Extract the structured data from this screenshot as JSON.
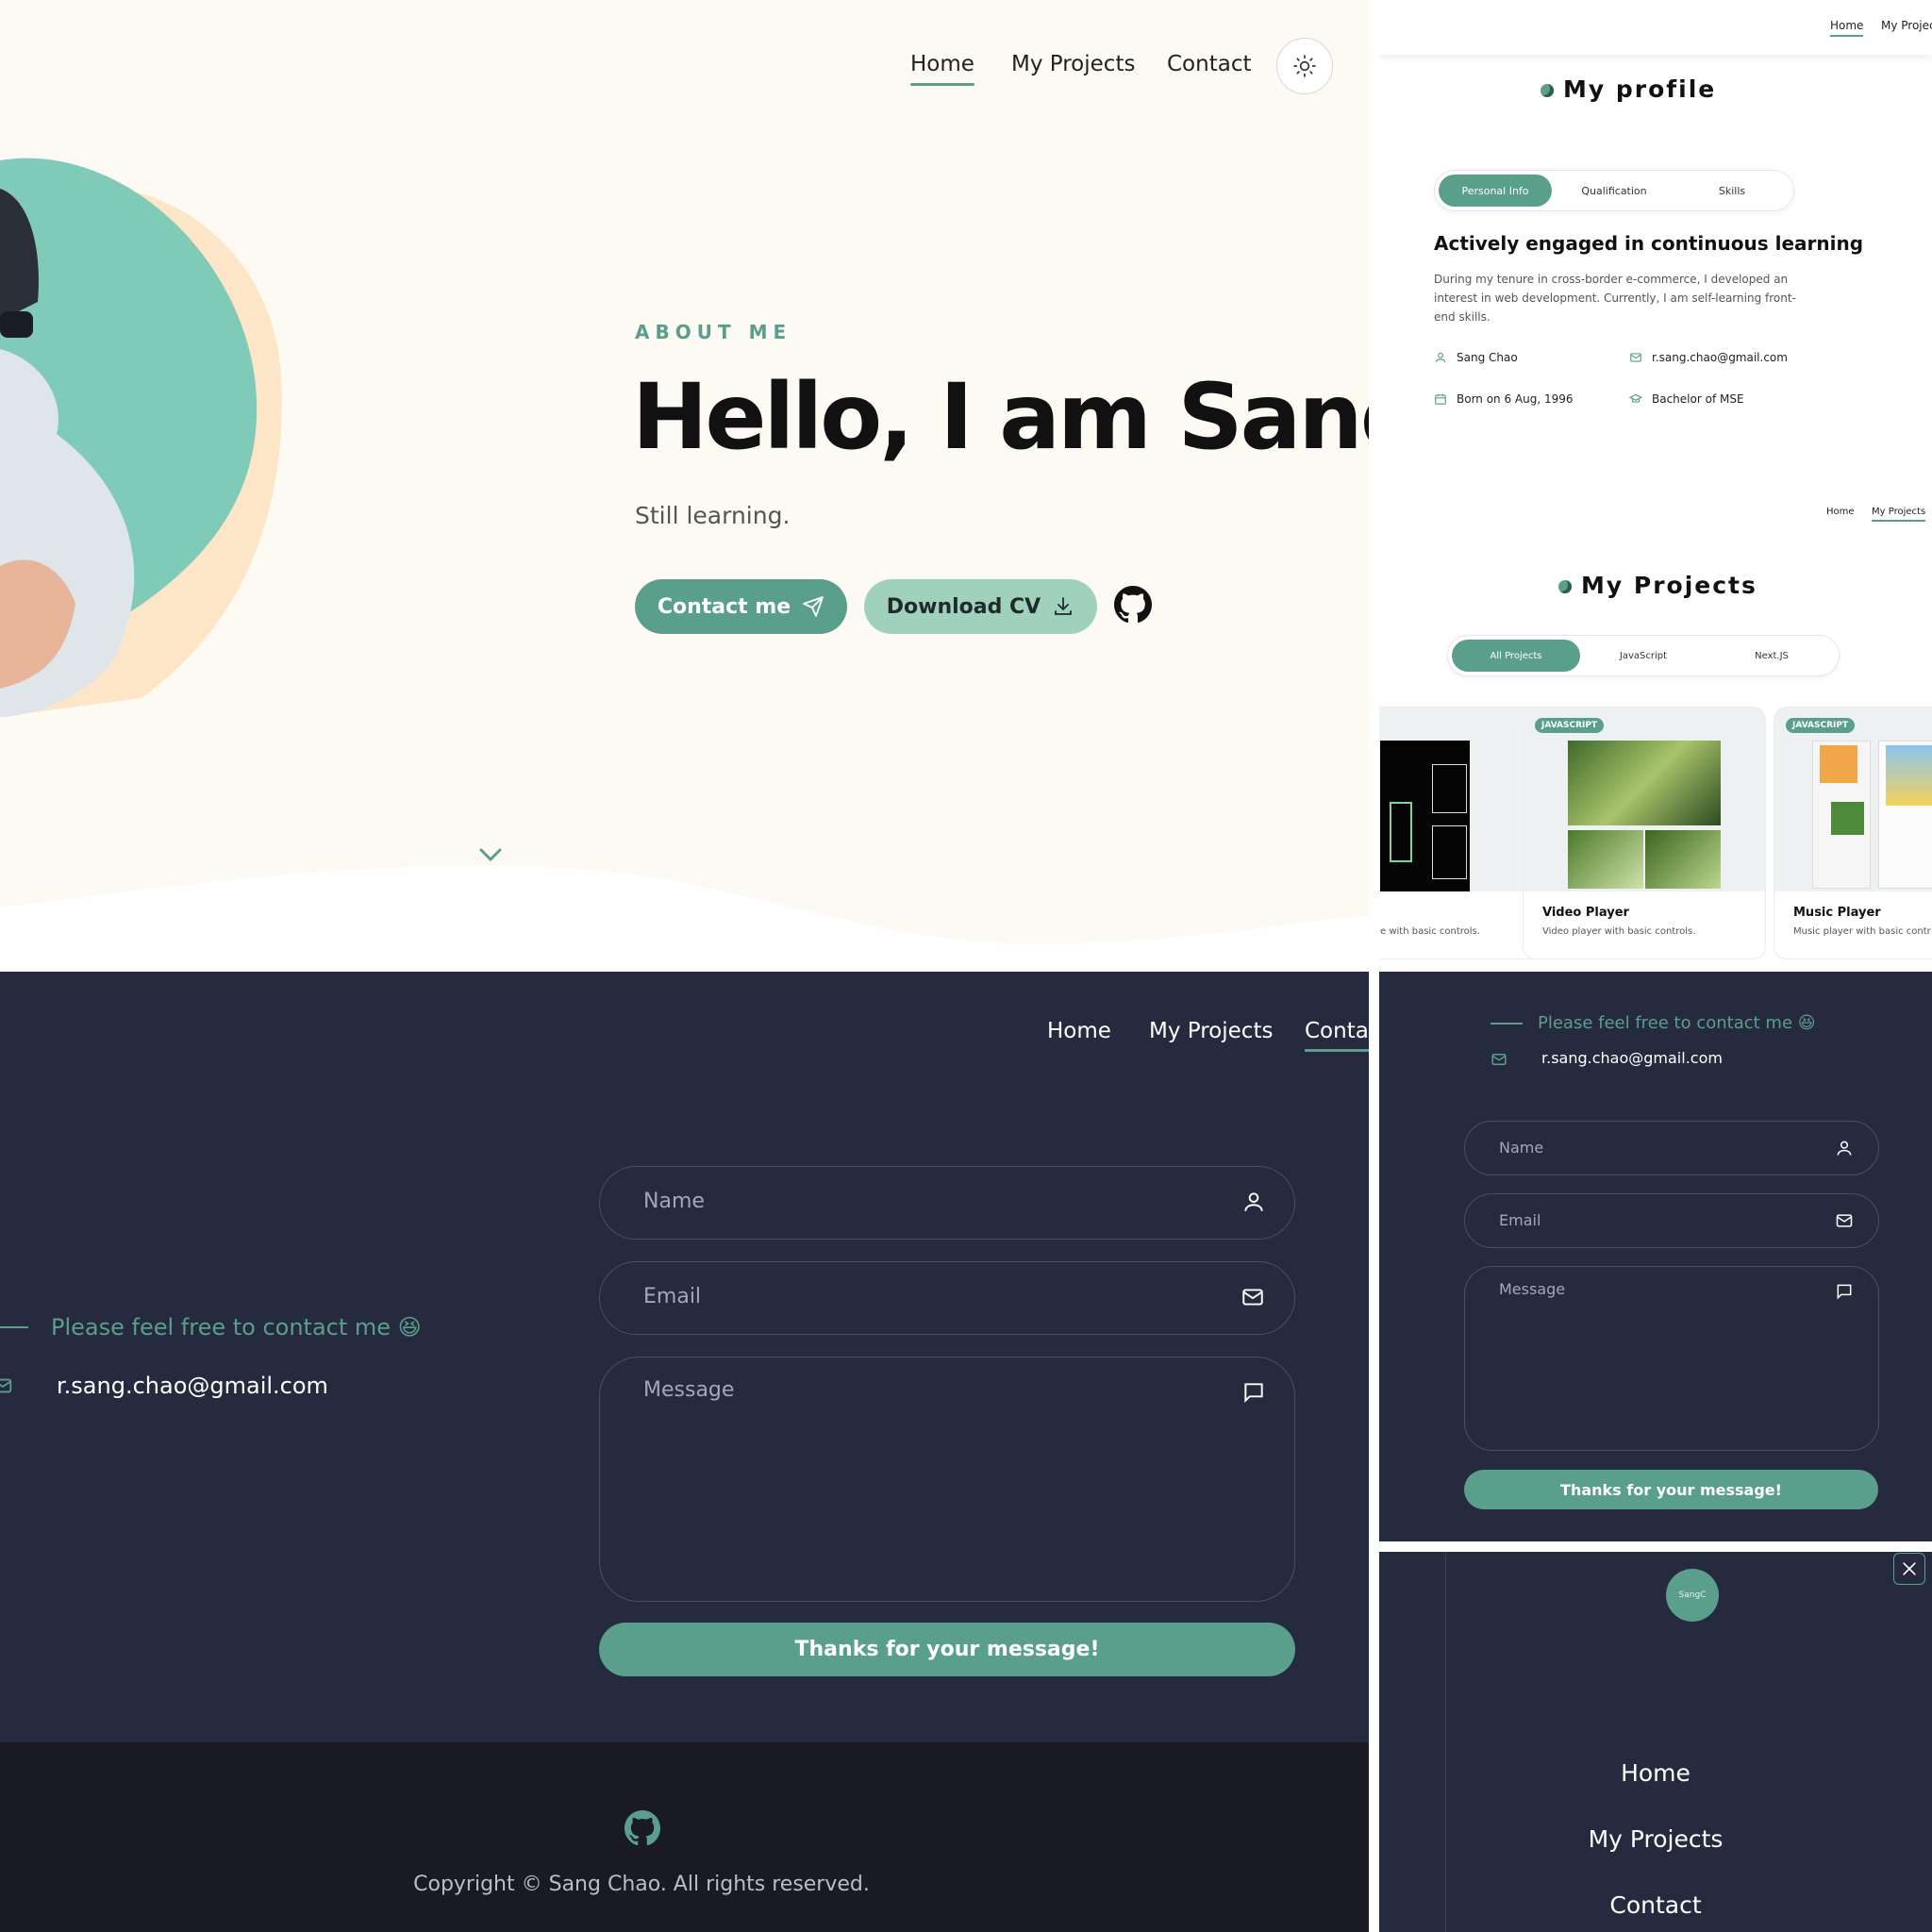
{
  "colors": {
    "accent": "#5a9e8c",
    "accent_light": "#9fd1bd",
    "dark_bg": "#262a3e",
    "cream_bg": "#fdfaf4",
    "footer_bg": "#1a1b22"
  },
  "hero": {
    "nav": {
      "home": "Home",
      "projects": "My Projects",
      "contact": "Contact"
    },
    "theme_icon": "sun-icon",
    "about_label": "ABOUT ME",
    "title": "Hello, I am Sang!",
    "subtitle": "Still learning.",
    "contact_btn": "Contact me",
    "cv_btn": "Download CV"
  },
  "profile": {
    "nav": {
      "home": "Home",
      "projects": "My Projects"
    },
    "title": "My profile",
    "tabs": [
      "Personal Info",
      "Qualification",
      "Skills"
    ],
    "heading": "Actively engaged in continuous learning",
    "description": "During my tenure in cross-border e-commerce, I developed an interest in web development. Currently, I am self-learning front-end skills.",
    "name": "Sang Chao",
    "email": "r.sang.chao@gmail.com",
    "born": "Born on 6 Aug, 1996",
    "degree": "Bachelor of MSE"
  },
  "projects": {
    "nav": {
      "home": "Home",
      "projects": "My Projects"
    },
    "title": "My Projects",
    "tabs": [
      "All Projects",
      "JavaScript",
      "Next.JS"
    ],
    "cards": [
      {
        "badge": "",
        "title": "",
        "desc": "e with basic controls."
      },
      {
        "badge": "JAVASCRIPT",
        "title": "Video Player",
        "desc": "Video player with basic controls."
      },
      {
        "badge": "JAVASCRIPT",
        "title": "Music Player",
        "desc": "Music player with basic contr"
      }
    ]
  },
  "contact": {
    "nav": {
      "home": "Home",
      "projects": "My Projects",
      "contact": "Contac"
    },
    "free_text": "Please feel free to contact me 😆",
    "email": "r.sang.chao@gmail.com",
    "name_ph": "Name",
    "email_ph": "Email",
    "message_ph": "Message",
    "submit": "Thanks for your message!",
    "copyright": "Copyright © Sang Chao. All rights reserved."
  },
  "contact_small": {
    "free_text": "Please feel free to contact me 😆",
    "email": "r.sang.chao@gmail.com",
    "name_ph": "Name",
    "email_ph": "Email",
    "message_ph": "Message",
    "submit": "Thanks for your message!"
  },
  "menu": {
    "logo_text": "SangC",
    "items": [
      "Home",
      "My Projects",
      "Contact"
    ]
  }
}
